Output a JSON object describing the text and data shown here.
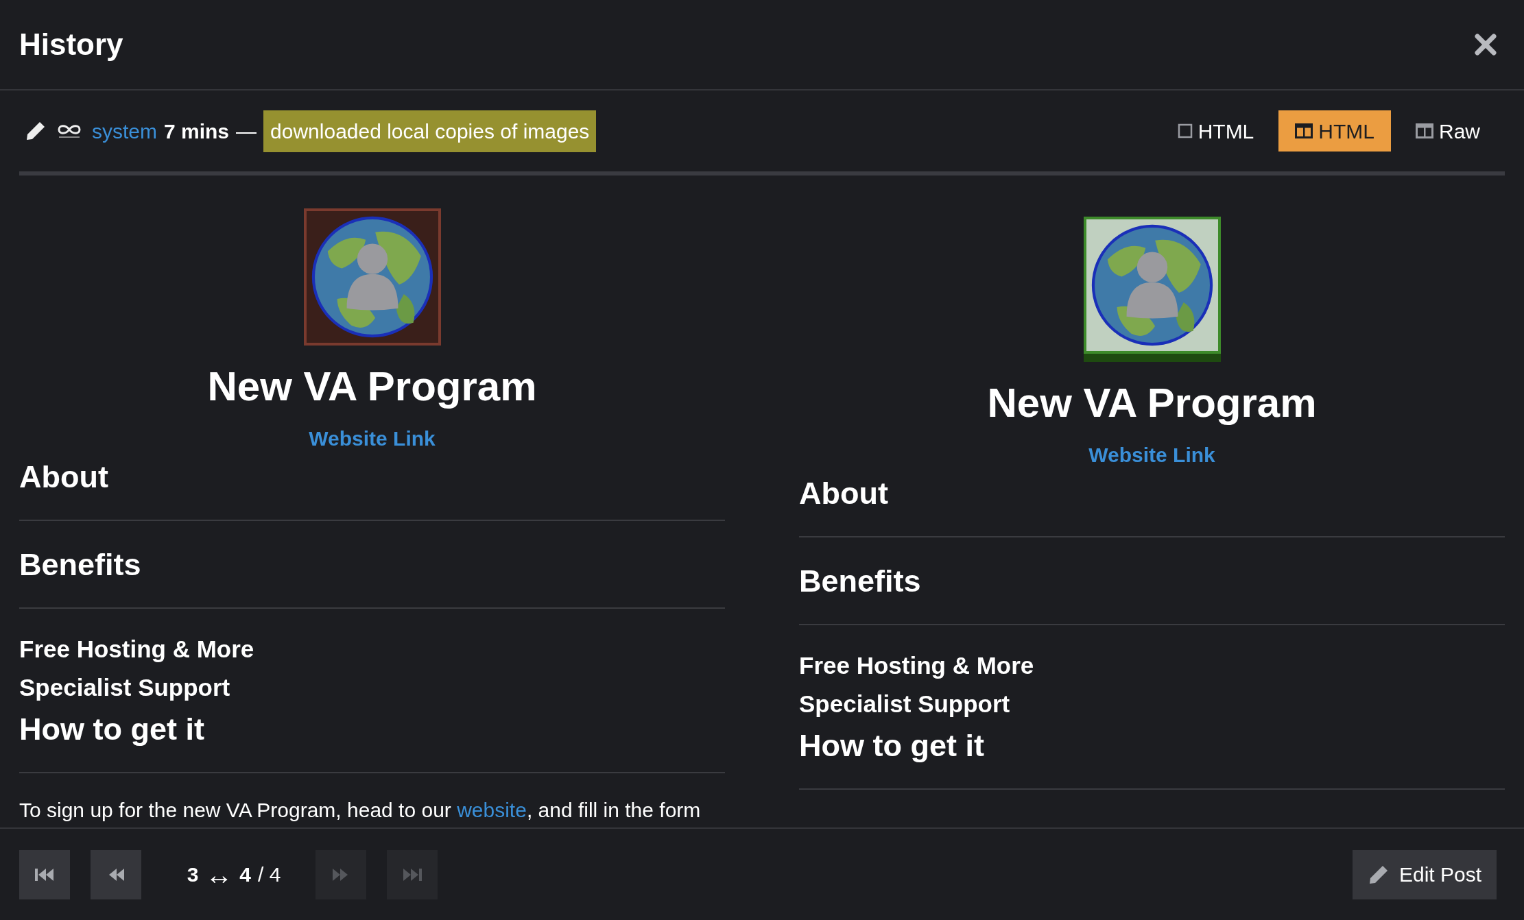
{
  "dialog": {
    "title": "History"
  },
  "revision": {
    "user": "system",
    "age": "7 mins",
    "separator": "—",
    "reason": "downloaded local copies of images"
  },
  "view_modes": [
    {
      "kind": "inline",
      "label": "HTML",
      "selected": false
    },
    {
      "kind": "side",
      "label": "HTML",
      "selected": true
    },
    {
      "kind": "raw",
      "label": "Raw",
      "selected": false
    }
  ],
  "columns": [
    {
      "image": {
        "removed": true
      },
      "title": "New VA Program",
      "link": "Website Link",
      "blocks": [
        {
          "kind": "h2",
          "text": "About"
        },
        {
          "kind": "rule"
        },
        {
          "kind": "h2",
          "text": "Benefits"
        },
        {
          "kind": "rule"
        },
        {
          "kind": "h3",
          "text": "Free Hosting & More"
        },
        {
          "kind": "h3",
          "text": "Specialist Support"
        },
        {
          "kind": "h2",
          "text": "How to get it"
        },
        {
          "kind": "rule"
        },
        {
          "kind": "paragraph",
          "parts": [
            {
              "text": "To sign up for the new VA Program, head to our "
            },
            {
              "text": "website",
              "link": true
            },
            {
              "text": ", and fill in the form"
            }
          ]
        }
      ]
    },
    {
      "image": {
        "removed": false
      },
      "title": "New VA Program",
      "link": "Website Link",
      "blocks": [
        {
          "kind": "h2",
          "text": "About"
        },
        {
          "kind": "rule"
        },
        {
          "kind": "h2",
          "text": "Benefits"
        },
        {
          "kind": "rule"
        },
        {
          "kind": "h3",
          "text": "Free Hosting & More"
        },
        {
          "kind": "h3",
          "text": "Specialist Support"
        },
        {
          "kind": "h2",
          "text": "How to get it"
        },
        {
          "kind": "rule"
        }
      ]
    }
  ],
  "navigation": {
    "buttons": [
      {
        "kind": "first",
        "disabled": false
      },
      {
        "kind": "previous",
        "disabled": false
      },
      {
        "kind": "next",
        "disabled": true
      },
      {
        "kind": "last",
        "disabled": true
      }
    ],
    "from": "3",
    "arrow": "↔",
    "to": "4",
    "total": "/ 4"
  },
  "edit_button": "Edit Post"
}
